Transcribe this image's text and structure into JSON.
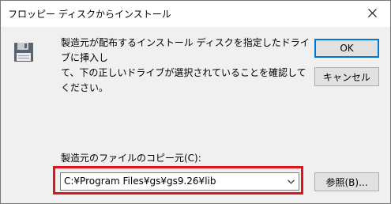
{
  "dialog": {
    "title": "フロッピー ディスクからインストール",
    "message": "製造元が配布するインストール ディスクを指定したドライブに挿入し\nて、下の正しいドライブが選択されていることを確認してください。",
    "ok_label": "OK",
    "cancel_label": "キャンセル",
    "source_label": "製造元のファイルのコピー元(C):",
    "source_value": "C:¥Program Files¥gs¥gs9.26¥lib",
    "browse_label": "参照(B)..."
  },
  "colors": {
    "highlight": "#e0141e",
    "default_button_border": "#0078d7",
    "window_background": "#f0f0f0"
  },
  "icons": {
    "close": "close-icon",
    "floppy": "floppy-disk-icon",
    "dropdown": "chevron-down-icon"
  }
}
